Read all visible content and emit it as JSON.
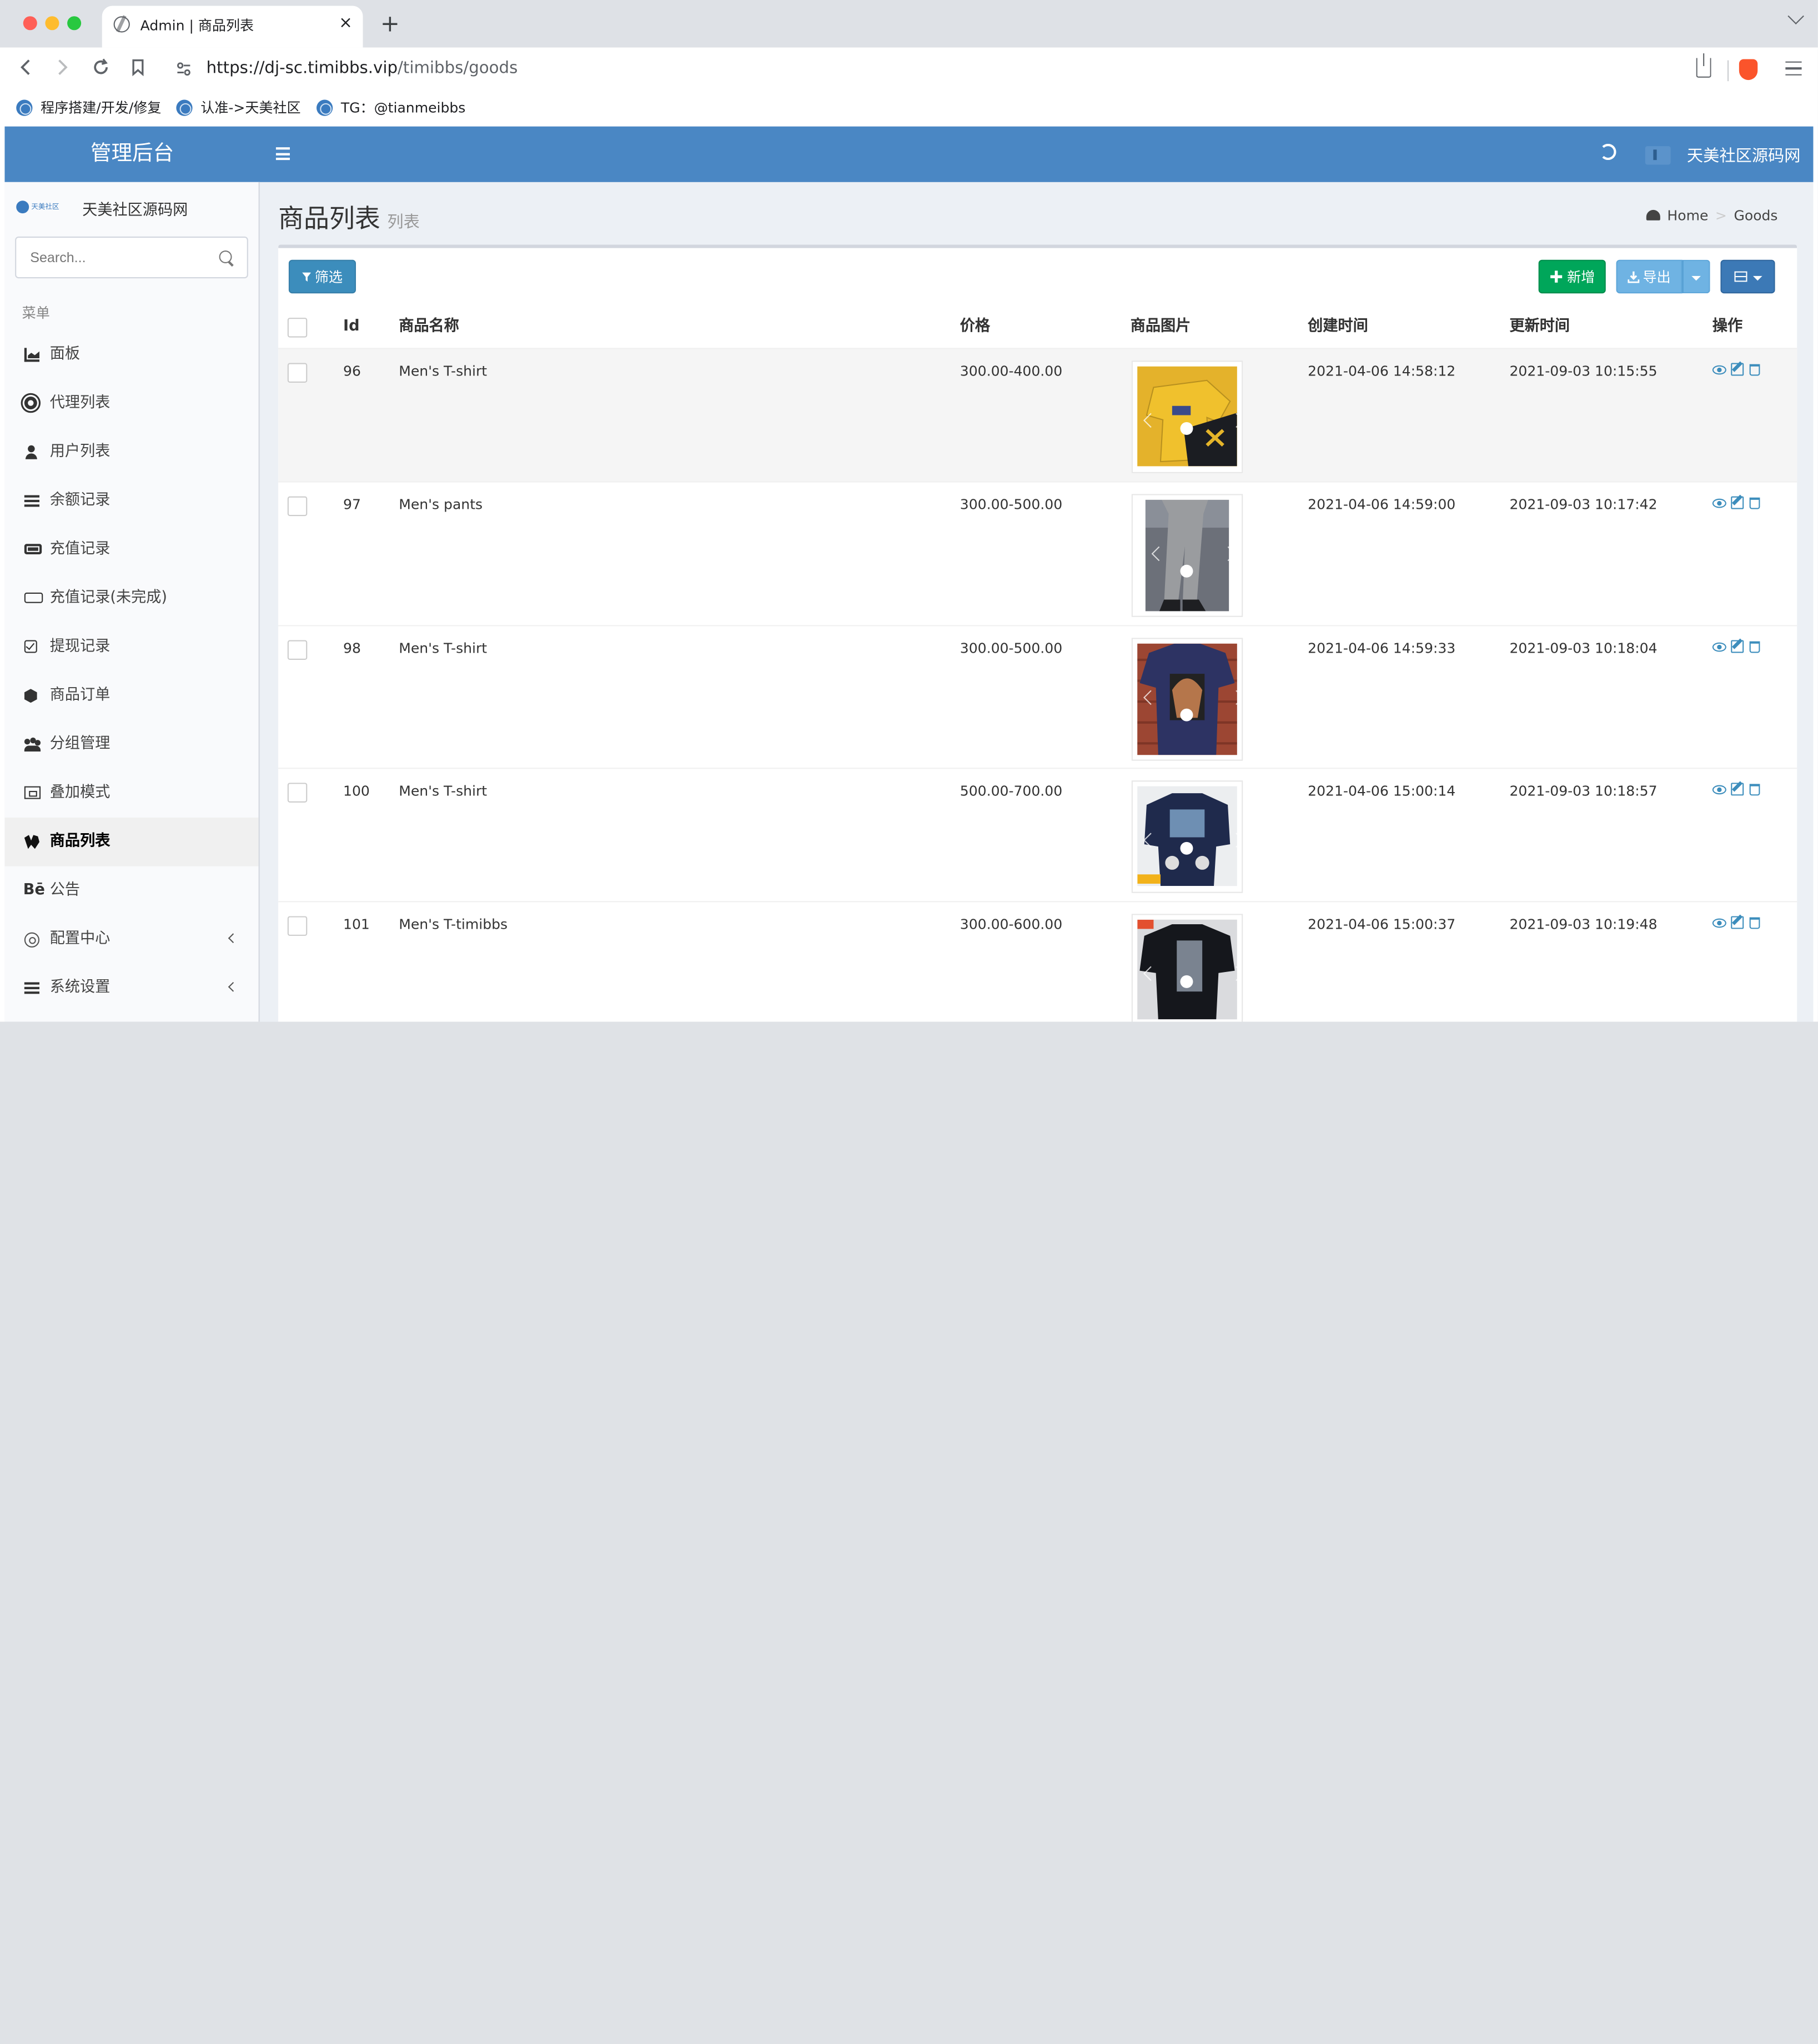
{
  "browser": {
    "tab_title": "Admin | 商品列表",
    "tab_close": "×",
    "new_tab": "+",
    "url_domain": "https://dj-sc.timibbs.vip",
    "url_path": "/timibbs/goods",
    "bookmarks": [
      "程序搭建/开发/修复",
      "认准->天美社区",
      "TG：@tianmeibbs"
    ]
  },
  "header": {
    "logo": "管理后台",
    "user": "天美社区源码网"
  },
  "sidebar": {
    "logo_text": "天美社区",
    "user": "天美社区源码网",
    "search_placeholder": "Search...",
    "menu_header": "菜单",
    "items": [
      {
        "label": "面板",
        "icon": "area-chart-icon"
      },
      {
        "label": "代理列表",
        "icon": "gear-icon"
      },
      {
        "label": "用户列表",
        "icon": "user-icon"
      },
      {
        "label": "余额记录",
        "icon": "list-icon"
      },
      {
        "label": "充值记录",
        "icon": "battery-full-icon"
      },
      {
        "label": "充值记录(未完成)",
        "icon": "battery-empty-icon"
      },
      {
        "label": "提现记录",
        "icon": "check-square-icon"
      },
      {
        "label": "商品订单",
        "icon": "cube-icon"
      },
      {
        "label": "分组管理",
        "icon": "users-icon"
      },
      {
        "label": "叠加模式",
        "icon": "object-group-icon"
      },
      {
        "label": "商品列表",
        "icon": "wpbeginner-icon",
        "active": true
      },
      {
        "label": "公告",
        "icon": "behance-icon"
      },
      {
        "label": "配置中心",
        "icon": "cog-icon",
        "has_children": true
      },
      {
        "label": "系统设置",
        "icon": "server-icon",
        "has_children": true
      }
    ],
    "behance_glyph": "Bē"
  },
  "page": {
    "title": "商品列表",
    "subtitle": "列表",
    "breadcrumb": [
      "Home",
      "Goods"
    ],
    "breadcrumb_sep": ">"
  },
  "toolbar": {
    "filter": "筛选",
    "add": "✚ 新增",
    "export": "导出"
  },
  "table": {
    "columns": [
      "Id",
      "商品名称",
      "价格",
      "商品图片",
      "创建时间",
      "更新时间",
      "操作"
    ],
    "rows": [
      {
        "id": "96",
        "name": "Men's T-shirt",
        "price": "300.00-400.00",
        "created": "2021-04-06 14:58:12",
        "updated": "2021-09-03 10:15:55"
      },
      {
        "id": "97",
        "name": "Men's pants",
        "price": "300.00-500.00",
        "created": "2021-04-06 14:59:00",
        "updated": "2021-09-03 10:17:42"
      },
      {
        "id": "98",
        "name": "Men's T-shirt",
        "price": "300.00-500.00",
        "created": "2021-04-06 14:59:33",
        "updated": "2021-09-03 10:18:04"
      },
      {
        "id": "100",
        "name": "Men's T-shirt",
        "price": "500.00-700.00",
        "created": "2021-04-06 15:00:14",
        "updated": "2021-09-03 10:18:57"
      },
      {
        "id": "101",
        "name": "Men's T-timibbs",
        "price": "300.00-600.00",
        "created": "2021-04-06 15:00:37",
        "updated": "2021-09-03 10:19:48"
      }
    ]
  },
  "colors": {
    "header": "#4a87c4",
    "primary": "#3c8dbc",
    "success": "#00a65a",
    "info": "#6fb3e3"
  }
}
